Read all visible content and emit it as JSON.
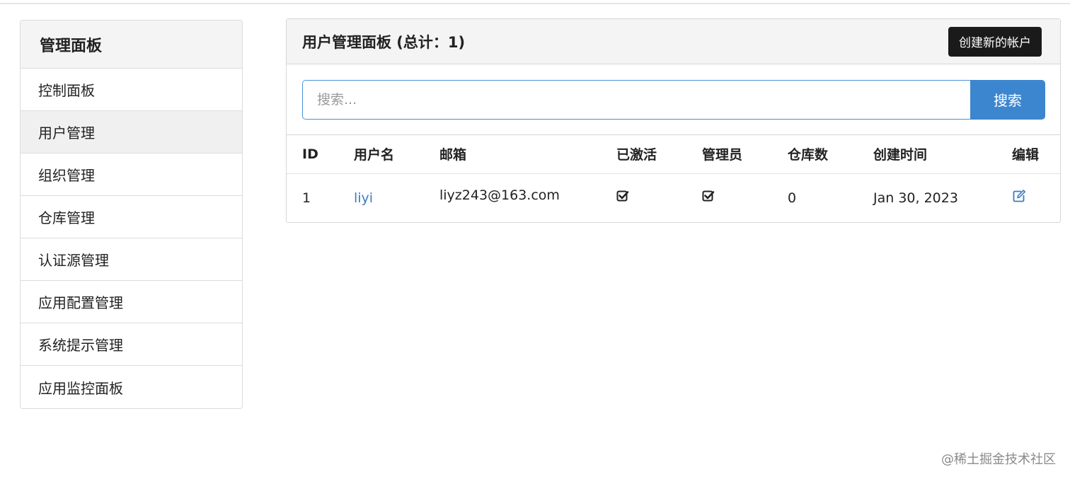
{
  "sidebar": {
    "title": "管理面板",
    "items": [
      {
        "label": "控制面板",
        "active": false
      },
      {
        "label": "用户管理",
        "active": true
      },
      {
        "label": "组织管理",
        "active": false
      },
      {
        "label": "仓库管理",
        "active": false
      },
      {
        "label": "认证源管理",
        "active": false
      },
      {
        "label": "应用配置管理",
        "active": false
      },
      {
        "label": "系统提示管理",
        "active": false
      },
      {
        "label": "应用监控面板",
        "active": false
      }
    ]
  },
  "panel": {
    "title": "用户管理面板 (总计：1)",
    "create_button": "创建新的帐户"
  },
  "search": {
    "placeholder": "搜索...",
    "value": "",
    "button": "搜索"
  },
  "table": {
    "columns": [
      "ID",
      "用户名",
      "邮箱",
      "已激活",
      "管理员",
      "仓库数",
      "创建时间",
      "编辑"
    ],
    "rows": [
      {
        "id": "1",
        "username": "liyi",
        "email": "liyz243@163.com",
        "activated": true,
        "admin": true,
        "repos": "0",
        "created": "Jan 30, 2023"
      }
    ]
  },
  "icons": {
    "activated": "checkbox-checked-icon",
    "admin": "checkbox-checked-icon",
    "edit": "edit-icon"
  },
  "colors": {
    "accent": "#3c86cf",
    "link": "#3c7cc0",
    "dark_button": "#1a1a1a"
  },
  "watermark": "@稀土掘金技术社区"
}
